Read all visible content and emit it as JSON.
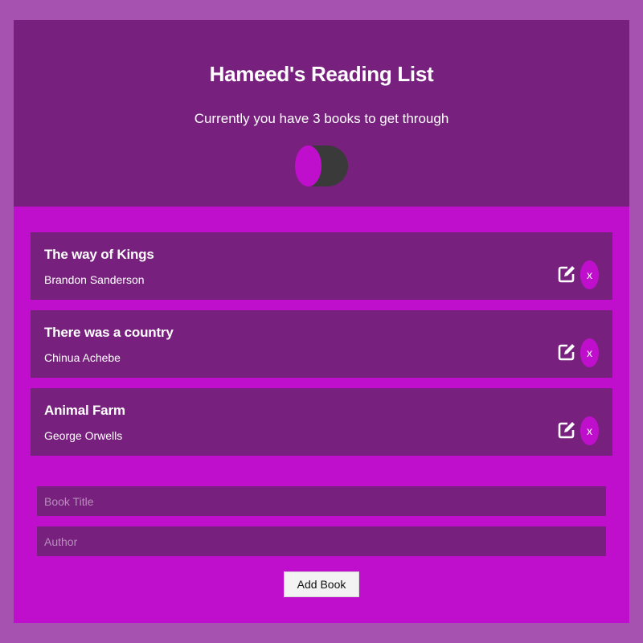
{
  "header": {
    "title": "Hameed's Reading List",
    "subtitle": "Currently you have 3 books to get through",
    "theme_toggle_state": "on"
  },
  "books": [
    {
      "title": "The way of Kings",
      "author": "Brandon Sanderson",
      "delete_label": "x",
      "edit_icon": "edit-icon"
    },
    {
      "title": "There was a country",
      "author": "Chinua Achebe",
      "delete_label": "x",
      "edit_icon": "edit-icon"
    },
    {
      "title": "Animal Farm",
      "author": "George Orwells",
      "delete_label": "x",
      "edit_icon": "edit-icon"
    }
  ],
  "form": {
    "title_value": "",
    "title_placeholder": "Book Title",
    "author_value": "",
    "author_placeholder": "Author",
    "submit_label": "Add Book"
  },
  "colors": {
    "page_background": "#a552b0",
    "accent": "#c00fcc",
    "panel": "#78207e",
    "toggle_track": "#3a3a3a"
  }
}
